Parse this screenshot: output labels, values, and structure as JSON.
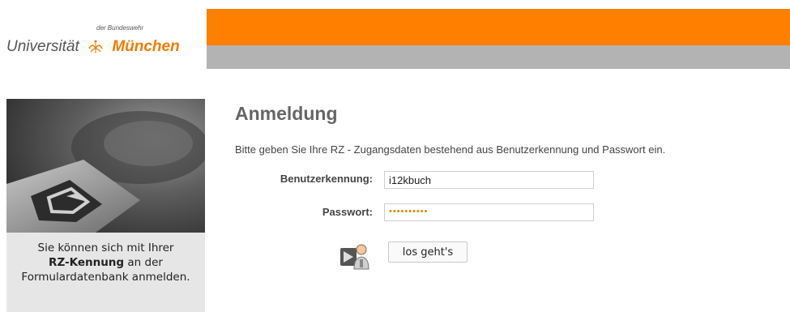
{
  "header": {
    "logo_small": "der Bundeswehr",
    "logo_left": "Universität",
    "logo_right": "München",
    "accent_color": "#ff7f00",
    "bar_color": "#b3b3b3"
  },
  "sidebar": {
    "text_pre": "Sie können sich mit Ihrer",
    "text_bold": "RZ-Kennung",
    "text_post": "an der Formulardatenbank anmelden."
  },
  "login": {
    "title": "Anmeldung",
    "intro": "Bitte geben Sie Ihre RZ - Zugangsdaten bestehend aus Benutzerkennung und Passwort ein.",
    "username_label": "Benutzerkennung:",
    "username_value": "i12kbuch",
    "password_label": "Passwort:",
    "password_value": "••••••••••",
    "submit_label": "los geht's",
    "submit_icon": "user-login-icon"
  }
}
